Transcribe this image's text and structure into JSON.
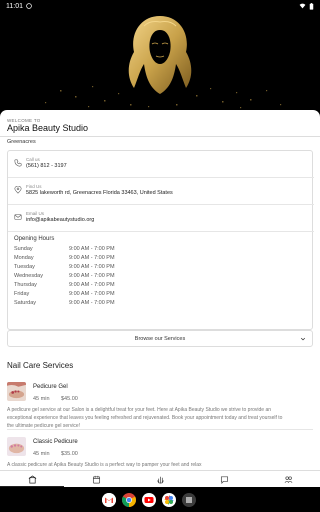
{
  "status_bar": {
    "time": "11:01"
  },
  "hero": {
    "image": "salon-logo-woman-golden-hair"
  },
  "header": {
    "welcome": "WELCOME TO",
    "business_name": "Apika Beauty Studio",
    "location": "Greenacres"
  },
  "contact": {
    "phone": {
      "label": "Call us",
      "value": "(561) 812 - 3197",
      "icon": "phone-icon"
    },
    "address": {
      "label": "Find Us",
      "value": "5825 lakeworth rd, Greenacres Florida 33463, United States",
      "icon": "location-pin-icon"
    },
    "email": {
      "label": "Email Us",
      "value": "info@apikabeautystudio.org",
      "icon": "email-icon"
    }
  },
  "hours": {
    "title": "Opening Hours",
    "days": [
      {
        "day": "Sunday",
        "time": "9:00 AM - 7:00 PM"
      },
      {
        "day": "Monday",
        "time": "9:00 AM - 7:00 PM"
      },
      {
        "day": "Tuesday",
        "time": "9:00 AM - 7:00 PM"
      },
      {
        "day": "Wednesday",
        "time": "9:00 AM - 7:00 PM"
      },
      {
        "day": "Thursday",
        "time": "9:00 AM - 7:00 PM"
      },
      {
        "day": "Friday",
        "time": "9:00 AM - 7:00 PM"
      },
      {
        "day": "Saturday",
        "time": "9:00 AM - 7:00 PM"
      }
    ]
  },
  "browse_button": "Browse our Services",
  "services_section": {
    "title": "Nail Care Services",
    "services": [
      {
        "name": "Pedicure Gel",
        "duration": "45 min",
        "price": "$45.00",
        "description": "A pedicure gel service at our Salon is a delightful treat for your feet. Here at Apika Beauty Studio we strive to provide an exceptional experience that leaves you feeling refreshed and rejuvenated. Book your appointment today and treat yourself to the ultimate pedicure gel service!"
      },
      {
        "name": "Classic Pedicure",
        "duration": "45 min",
        "price": "$35.00",
        "description": "A classic pedicure at Apika Beauty Studio is a perfect way to pamper your feet and relax"
      }
    ]
  },
  "bottom_nav": [
    "home-icon",
    "calendar-icon",
    "hand-icon",
    "chat-icon",
    "team-icon"
  ],
  "dock_apps": [
    "gmail-icon",
    "chrome-icon",
    "youtube-icon",
    "photos-icon",
    "app-drawer-icon"
  ],
  "colors": {
    "accent": "#c9a24a",
    "hero_bg": "#000000"
  }
}
